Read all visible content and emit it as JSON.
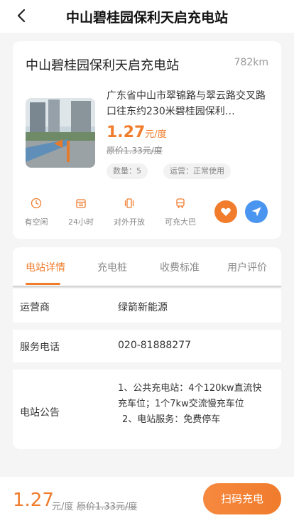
{
  "header": {
    "title": "中山碧桂园保利天启充电站"
  },
  "station": {
    "name": "中山碧桂园保利天启充电站",
    "distance": "782km",
    "address": "广东省中山市翠锦路与翠云路交叉路口往东约230米碧桂园保利…",
    "price": "1.27",
    "price_unit": "元/度",
    "original_price": "原价1.33元/度",
    "count_tag": "数量：5",
    "status_tag": "运营：正常使用"
  },
  "features": [
    {
      "icon": "clock-icon",
      "label": "有空闲"
    },
    {
      "icon": "calendar-icon",
      "label": "24小时"
    },
    {
      "icon": "open-icon",
      "label": "对外开放"
    },
    {
      "icon": "bus-icon",
      "label": "可充大巴"
    }
  ],
  "tabs": [
    {
      "label": "电站详情",
      "active": true
    },
    {
      "label": "充电桩",
      "active": false
    },
    {
      "label": "收费标准",
      "active": false
    },
    {
      "label": "用户评价",
      "active": false
    }
  ],
  "details": {
    "operator_label": "运营商",
    "operator_value": "绿箭新能源",
    "phone_label": "服务电话",
    "phone_value": "020-81888277",
    "notice_label": "电站公告",
    "notice_line1": "1、公共充电站：4个120kw直流快充车位；1个7kw交流慢充车位",
    "notice_line2": "2、电站服务：免费停车"
  },
  "bottom": {
    "price": "1.27",
    "unit": "元/度",
    "original": "原价1.33元/度",
    "scan_label": "扫码充电"
  },
  "colors": {
    "accent": "#f07c2c",
    "blue": "#4a95f0"
  }
}
